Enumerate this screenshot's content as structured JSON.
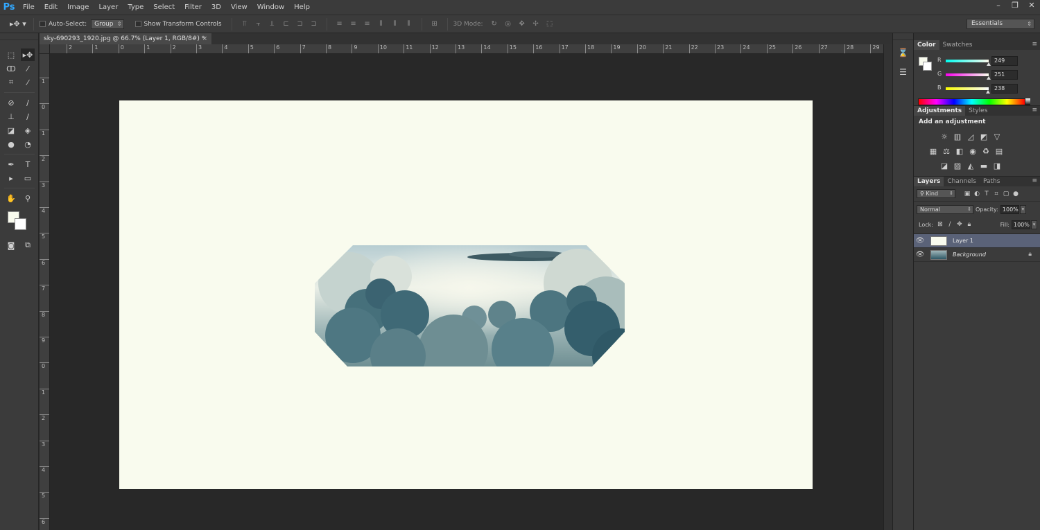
{
  "app": {
    "logo": "Ps"
  },
  "menu": [
    "File",
    "Edit",
    "Image",
    "Layer",
    "Type",
    "Select",
    "Filter",
    "3D",
    "View",
    "Window",
    "Help"
  ],
  "window_controls": [
    "minimize-icon",
    "restore-icon",
    "close-icon"
  ],
  "options_bar": {
    "auto_select_label": "Auto-Select:",
    "auto_select_value": "Group",
    "show_transform_label": "Show Transform Controls",
    "mode_3d_label": "3D Mode:",
    "workspace": "Essentials"
  },
  "document": {
    "tab_title": "sky-690293_1920.jpg @ 66.7% (Layer 1, RGB/8#) *",
    "tab_close": "×",
    "background_color": "#f9fbee"
  },
  "ruler_top": [
    "2",
    "1",
    "0",
    "1",
    "2",
    "3",
    "4",
    "5",
    "6",
    "7",
    "8",
    "9",
    "10",
    "11",
    "12",
    "13",
    "14",
    "15",
    "16",
    "17",
    "18",
    "19",
    "20",
    "21",
    "22",
    "23",
    "24",
    "25",
    "26",
    "27",
    "28",
    "29"
  ],
  "ruler_left": [
    "1",
    "0",
    "1",
    "2",
    "3",
    "4",
    "5",
    "6",
    "7",
    "8",
    "9",
    "0",
    "1",
    "2",
    "3",
    "4",
    "5",
    "6"
  ],
  "color_panel": {
    "tabs": [
      "Color",
      "Swatches"
    ],
    "r_label": "R",
    "r_value": "249",
    "g_label": "G",
    "g_value": "251",
    "b_label": "B",
    "b_value": "238",
    "foreground": "#f9fbee"
  },
  "adjustments_panel": {
    "tabs": [
      "Adjustments",
      "Styles"
    ],
    "title": "Add an adjustment"
  },
  "layers_panel": {
    "tabs": [
      "Layers",
      "Channels",
      "Paths"
    ],
    "filter_kind": "Kind",
    "blend_mode": "Normal",
    "opacity_label": "Opacity:",
    "opacity_value": "100%",
    "lock_label": "Lock:",
    "fill_label": "Fill:",
    "fill_value": "100%",
    "layers": [
      {
        "name": "Layer 1",
        "selected": true
      },
      {
        "name": "Background",
        "selected": false,
        "locked": true
      }
    ]
  },
  "colors": {
    "accent_selection": "#5a6278",
    "ps_blue": "#31a8ff"
  }
}
